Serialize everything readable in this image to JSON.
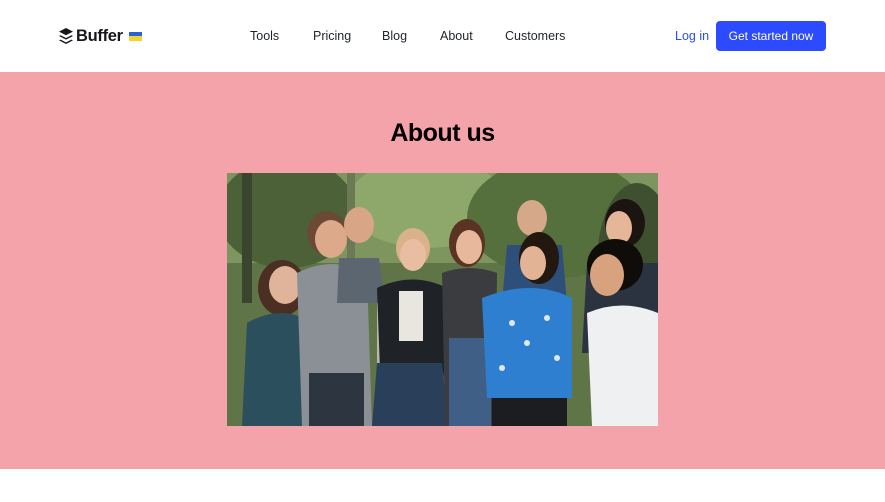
{
  "brand": {
    "name": "Buffer",
    "logo_icon": "stacked-layers-icon",
    "flag_icon": "ukraine-flag-icon",
    "flag_colors": [
      "#2a62d6",
      "#f4d233"
    ]
  },
  "nav": {
    "items": [
      "Tools",
      "Pricing",
      "Blog",
      "About",
      "Customers"
    ]
  },
  "header_actions": {
    "login_label": "Log in",
    "cta_label": "Get started now"
  },
  "hero": {
    "title": "About us",
    "photo_subject": "team-photo",
    "background_color": "#f5a3aa"
  },
  "colors": {
    "accent": "#2c4bff",
    "text": "#1f232b"
  }
}
